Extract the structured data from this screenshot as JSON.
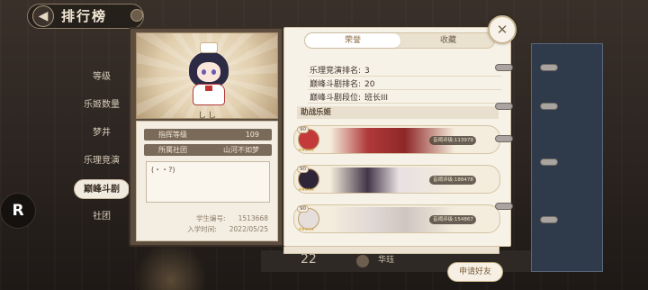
{
  "header": {
    "title": "排行榜"
  },
  "categories": [
    {
      "label": "等级",
      "active": false
    },
    {
      "label": "乐姬数量",
      "active": false
    },
    {
      "label": "梦井",
      "active": false
    },
    {
      "label": "乐理竞演",
      "active": false
    },
    {
      "label": "巅峰斗剧",
      "active": true
    },
    {
      "label": "社团",
      "active": false
    }
  ],
  "profile": {
    "name": "しし",
    "command_level_label": "指挥等级",
    "command_level": "109",
    "club_label": "所属社团",
    "club": "山河不如梦",
    "signature": "(・・?)",
    "student_id_label": "学生编号:",
    "student_id": "1513668",
    "enroll_label": "入学时间:",
    "enroll_date": "2022/05/25"
  },
  "dialog": {
    "tabs": [
      {
        "label": "荣誉",
        "active": true
      },
      {
        "label": "收藏",
        "active": false
      }
    ],
    "stats": [
      {
        "label": "乐理竞演排名:",
        "value": "3"
      },
      {
        "label": "巅峰斗剧排名:",
        "value": "20"
      },
      {
        "label": "巅峰斗剧段位:",
        "value": "班长III"
      }
    ],
    "assist_title": "助战乐姬",
    "assists": [
      {
        "level": "90",
        "stars": "★★★★★",
        "power_label": "音阈评级:",
        "power": "113979",
        "avatar_color": "#c43a3a",
        "art_color": "#9e2c2c"
      },
      {
        "level": "90",
        "stars": "★★★★★",
        "power_label": "音阈评级:",
        "power": "188478",
        "avatar_color": "#2e2638",
        "art_color": "#3a3040"
      },
      {
        "level": "90",
        "stars": "★★★★★",
        "power_label": "音阈评级:",
        "power": "154867",
        "avatar_color": "#e6dedb",
        "art_color": "#d8cfcb"
      }
    ],
    "close_icon": "close-x-icon",
    "friend_button": "申请好友"
  },
  "background": {
    "rank_number": "22",
    "row_text": "华珏"
  },
  "brand": {
    "logo_text": "R"
  },
  "colors": {
    "accent": "#8a6a44",
    "panel": "#f7f2e8",
    "card_dark": "#5d4d3f"
  }
}
